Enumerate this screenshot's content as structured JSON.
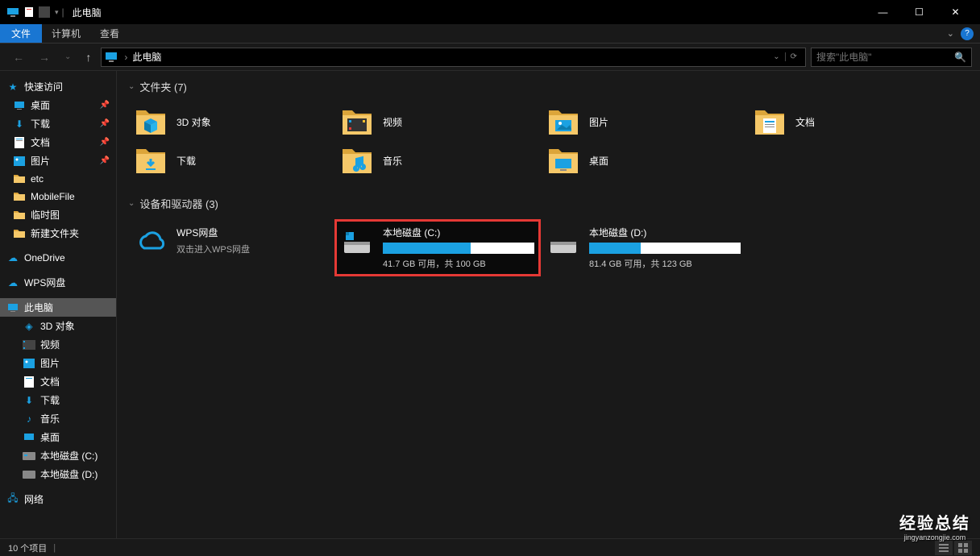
{
  "window": {
    "title": "此电脑",
    "min": "—",
    "max": "☐",
    "close": "✕"
  },
  "menu": {
    "file": "文件",
    "computer": "计算机",
    "view": "查看",
    "dropdown": "⌄",
    "help": "?"
  },
  "nav": {
    "back": "←",
    "forward": "→",
    "history": "⌄",
    "up": "↑",
    "location": "此电脑",
    "sep": "›",
    "addrdrop": "⌄",
    "refresh": "⟳"
  },
  "search": {
    "placeholder": "搜索\"此电脑\"",
    "icon": "🔍"
  },
  "sidebar": {
    "quickaccess": "快速访问",
    "items_qa": [
      {
        "label": "桌面",
        "pin": true,
        "icon": "monitor-blue"
      },
      {
        "label": "下载",
        "pin": true,
        "icon": "folder-arrow"
      },
      {
        "label": "文档",
        "pin": true,
        "icon": "doc"
      },
      {
        "label": "图片",
        "pin": true,
        "icon": "pic"
      },
      {
        "label": "etc",
        "pin": false,
        "icon": "folder"
      },
      {
        "label": "MobileFile",
        "pin": false,
        "icon": "folder"
      },
      {
        "label": "临时图",
        "pin": false,
        "icon": "folder"
      },
      {
        "label": "新建文件夹",
        "pin": false,
        "icon": "folder"
      }
    ],
    "onedrive": "OneDrive",
    "wps": "WPS网盘",
    "thispc": "此电脑",
    "items_pc": [
      {
        "label": "3D 对象",
        "icon": "cube"
      },
      {
        "label": "视频",
        "icon": "video"
      },
      {
        "label": "图片",
        "icon": "pic"
      },
      {
        "label": "文档",
        "icon": "doc"
      },
      {
        "label": "下载",
        "icon": "folder-arrow"
      },
      {
        "label": "音乐",
        "icon": "music"
      },
      {
        "label": "桌面",
        "icon": "monitor-blue"
      },
      {
        "label": "本地磁盘 (C:)",
        "icon": "drive"
      },
      {
        "label": "本地磁盘 (D:)",
        "icon": "drive"
      }
    ],
    "network": "网络"
  },
  "content": {
    "folders_header": "文件夹 (7)",
    "drives_header": "设备和驱动器 (3)",
    "folders": [
      {
        "label": "3D 对象",
        "accent": "cube"
      },
      {
        "label": "视频",
        "accent": "video"
      },
      {
        "label": "图片",
        "accent": "pic"
      },
      {
        "label": "文档",
        "accent": "doc"
      },
      {
        "label": "下载",
        "accent": "download"
      },
      {
        "label": "音乐",
        "accent": "music"
      },
      {
        "label": "桌面",
        "accent": "desktop"
      }
    ],
    "drives": {
      "wps": {
        "name": "WPS网盘",
        "sub": "双击进入WPS网盘"
      },
      "c": {
        "name": "本地磁盘 (C:)",
        "status": "41.7 GB 可用，共 100 GB",
        "fill_pct": 58
      },
      "d": {
        "name": "本地磁盘 (D:)",
        "status": "81.4 GB 可用，共 123 GB",
        "fill_pct": 34
      }
    }
  },
  "statusbar": {
    "count": "10 个项目"
  },
  "watermark": {
    "main": "经验总结",
    "sub": "jingyanzongjie.com"
  }
}
